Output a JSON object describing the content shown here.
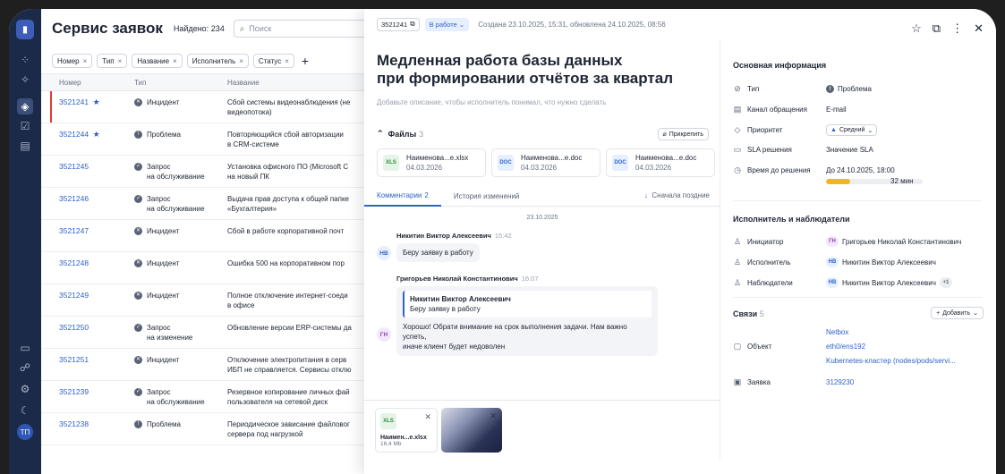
{
  "app": {
    "title": "Сервис заявок",
    "found": "Найдено: 234",
    "search_placeholder": "Поиск",
    "rail_avatar": "ТП"
  },
  "filters": [
    {
      "label": "Номер"
    },
    {
      "label": "Тип"
    },
    {
      "label": "Название"
    },
    {
      "label": "Исполнитель"
    },
    {
      "label": "Статус"
    }
  ],
  "table": {
    "headers": [
      "Номер",
      "Тип",
      "Название"
    ],
    "rows": [
      {
        "num": "3521241",
        "starred": true,
        "type": "Инцидент",
        "type_line2": "",
        "name": "Сбой системы видеонаблюдения (не",
        "name_line2": "видеопотока)"
      },
      {
        "num": "3521244",
        "starred": true,
        "type": "Проблема",
        "type_line2": "",
        "name": "Повторяющийся сбой авторизации",
        "name_line2": "в CRM-системе"
      },
      {
        "num": "3521245",
        "starred": false,
        "type": "Запрос",
        "type_line2": "на обслуживание",
        "name": "Установка офисного ПО (Microsoft C",
        "name_line2": "на новый ПК"
      },
      {
        "num": "3521246",
        "starred": false,
        "type": "Запрос",
        "type_line2": "на обслуживание",
        "name": "Выдача прав доступа к общей папке",
        "name_line2": "«Бухгалтерия»"
      },
      {
        "num": "3521247",
        "starred": false,
        "type": "Инцидент",
        "type_line2": "",
        "name": "Сбой в работе корпоративной почт",
        "name_line2": ""
      },
      {
        "num": "3521248",
        "starred": false,
        "type": "Инцидент",
        "type_line2": "",
        "name": "Ошибка 500 на корпоративном пор",
        "name_line2": ""
      },
      {
        "num": "3521249",
        "starred": false,
        "type": "Инцидент",
        "type_line2": "",
        "name": "Полное отключение интернет-соеди",
        "name_line2": "в офисе"
      },
      {
        "num": "3521250",
        "starred": false,
        "type": "Запрос",
        "type_line2": "на изменение",
        "name": "Обновление версии ERP-системы да",
        "name_line2": ""
      },
      {
        "num": "3521251",
        "starred": false,
        "type": "Инцидент",
        "type_line2": "",
        "name": "Отключение электропитания в серв",
        "name_line2": "ИБП не справляется. Сервисы отклю"
      },
      {
        "num": "3521239",
        "starred": false,
        "type": "Запрос",
        "type_line2": "на обслуживание",
        "name": "Резервное копирование личных фай",
        "name_line2": "пользователя на сетевой диск"
      },
      {
        "num": "3521238",
        "starred": false,
        "type": "Проблема",
        "type_line2": "",
        "name": "Периодическое зависание файловог",
        "name_line2": "сервера под нагрузкой"
      }
    ]
  },
  "ticket": {
    "id": "3521241",
    "status": "В работе",
    "created": "Создана 23.10.2025, 15:31, обновлена 24.10.2025, 08:56",
    "title_line1": "Медленная работа базы данных",
    "title_line2": "при формировании отчётов за квартал",
    "description_placeholder": "Добавьте описание, чтобы исполнитель понимал, что нужно сделать",
    "files_label": "Файлы",
    "files_count": "3",
    "attach_label": "Прикрепить",
    "files": [
      {
        "badge": "XLS",
        "kind": "xls",
        "name": "Наименова...e.xlsx",
        "date": "04.03.2026"
      },
      {
        "badge": "DOC",
        "kind": "doc",
        "name": "Наименова...e.doc",
        "date": "04.03.2026"
      },
      {
        "badge": "DOC",
        "kind": "doc",
        "name": "Наименова...e.doc",
        "date": "04.03.2026"
      }
    ],
    "tabs": [
      {
        "label": "Комментарии",
        "count": "2"
      },
      {
        "label": "История изменений",
        "count": ""
      }
    ],
    "sort_label": "Сначала поздние",
    "date_separator": "23.10.2025",
    "comments": [
      {
        "author": "Никитин Виктор Алексеевич",
        "time": "15:42",
        "initials": "НВ",
        "text": "Беру заявку в работу"
      },
      {
        "author": "Григорьев Николай Константинович",
        "time": "16:07",
        "initials": "ГН",
        "quote_author": "Никитин Виктор Алексеевич",
        "quote_text": "Беру заявку в работу",
        "text_line1": "Хорошо! Обрати внимание на срок выполнения задачи. Нам важно успеть,",
        "text_line2": "иначе клиент будет недоволен"
      }
    ],
    "draft_attachment": {
      "badge": "XLS",
      "name": "Наимен...e.xlsx",
      "size": "16,4 Mb"
    }
  },
  "info": {
    "main_header": "Основная информация",
    "fields": [
      {
        "key": "Тип",
        "value": "Проблема"
      },
      {
        "key": "Канал обращения",
        "value": "E-mail"
      },
      {
        "key": "Приоритет",
        "value": "Средний"
      },
      {
        "key": "SLA решения",
        "value": "Значение SLA"
      },
      {
        "key": "Время до решения",
        "value": "До 24.10.2025, 18:00"
      }
    ],
    "sla_remaining": "32 мин",
    "sla_progress": 0.25,
    "people_header": "Исполнитель и наблюдатели",
    "people": [
      {
        "key": "Инициатор",
        "initials": "ГН",
        "name": "Григорьев Николай Константинович",
        "extra": ""
      },
      {
        "key": "Исполнитель",
        "initials": "НВ",
        "name": "Никитин Виктор Алексеевич",
        "extra": ""
      },
      {
        "key": "Наблюдатели",
        "initials": "НВ",
        "name": "Никитин Виктор Алексеевич",
        "extra": "+1"
      }
    ],
    "links_header": "Связи",
    "links_count": "5",
    "add_label": "Добавить",
    "object_key": "Объект",
    "object_values": [
      "Netbox",
      "eth0/ens192",
      "Kubernetes-кластер (nodes/pods/servi..."
    ],
    "request_key": "Заявка",
    "request_value": "3129230"
  },
  "colors": {
    "accent": "#2f62c9",
    "rail": "#1c2a4a",
    "sla": "#f5b324",
    "selected_marker": "#e53935"
  }
}
